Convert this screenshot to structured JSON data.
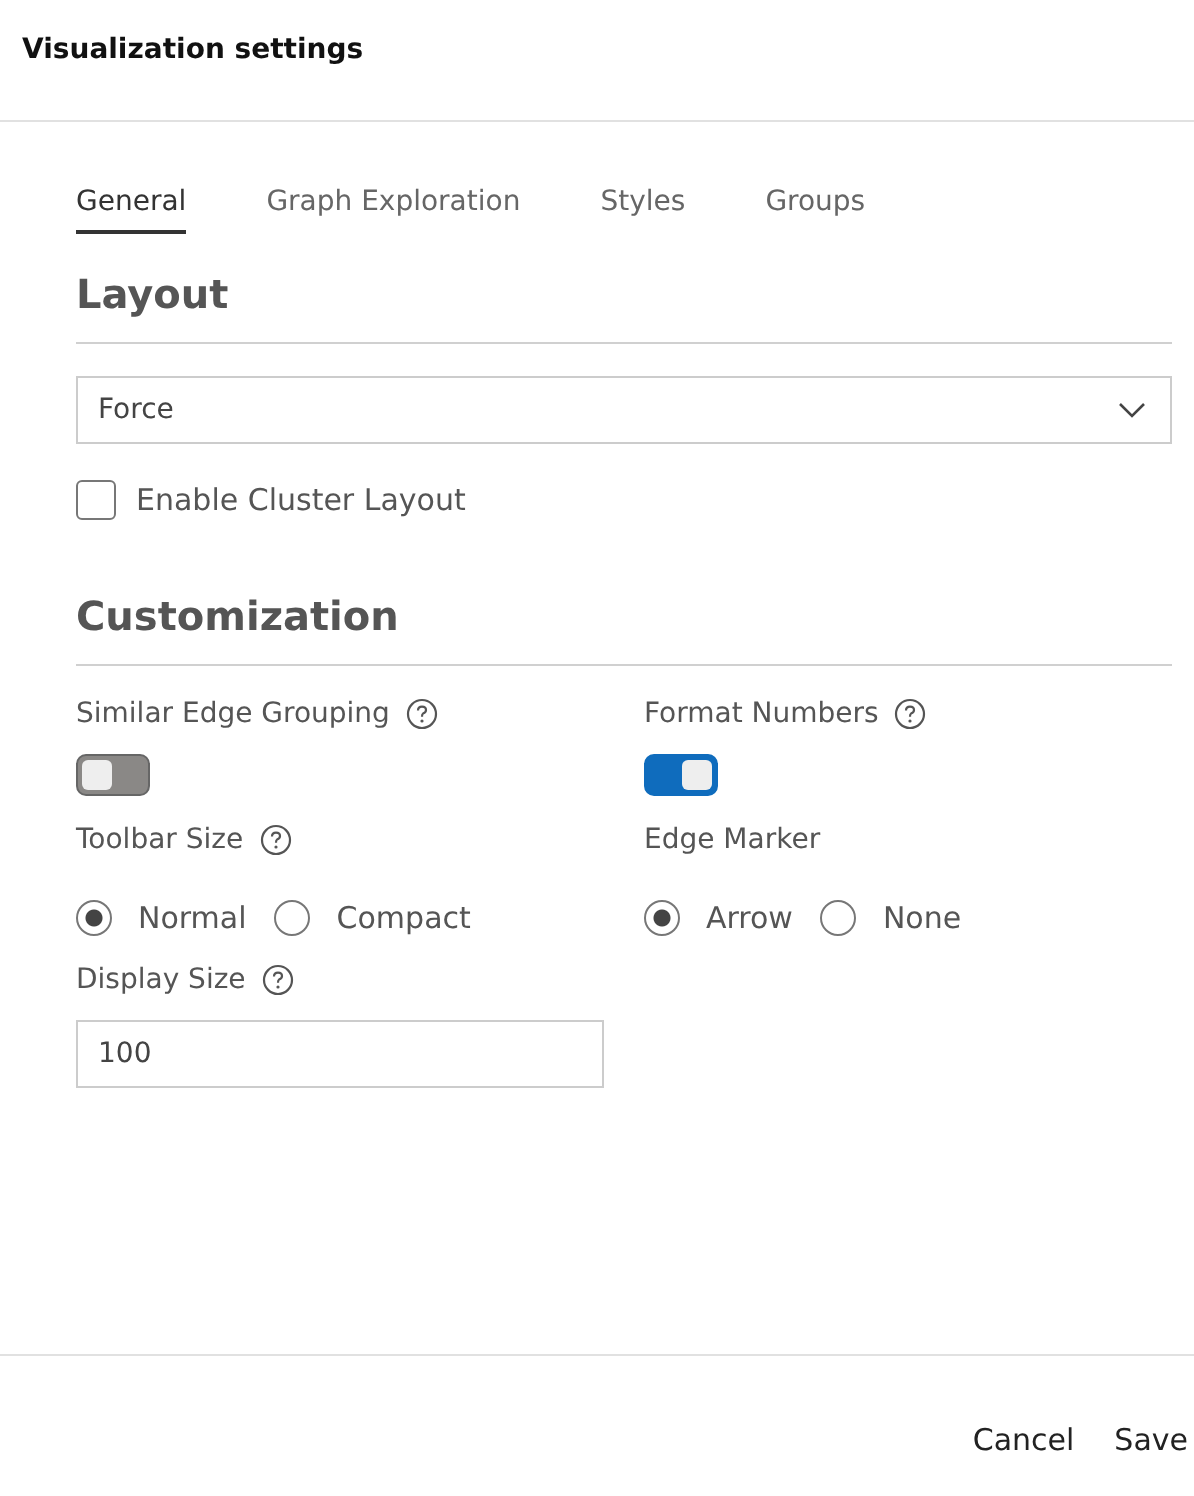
{
  "window": {
    "title": "Visualization settings"
  },
  "tabs": [
    {
      "label": "General",
      "selected": true
    },
    {
      "label": "Graph Exploration",
      "selected": false
    },
    {
      "label": "Styles",
      "selected": false
    },
    {
      "label": "Groups",
      "selected": false
    }
  ],
  "layout": {
    "heading": "Layout",
    "dropdown": {
      "value": "Force"
    },
    "checkbox": {
      "label": "Enable Cluster Layout",
      "checked": false
    }
  },
  "customization": {
    "heading": "Customization",
    "toggles": [
      {
        "label": "Similar Edge Grouping",
        "help": true,
        "on": false
      },
      {
        "label": "Format Numbers",
        "help": true,
        "on": true
      }
    ],
    "radio_groups": [
      {
        "label": "Toolbar Size",
        "help": true,
        "options": [
          {
            "label": "Normal",
            "selected": true
          },
          {
            "label": "Compact",
            "selected": false
          }
        ]
      },
      {
        "label": "Edge Marker",
        "help": false,
        "options": [
          {
            "label": "Arrow",
            "selected": true
          },
          {
            "label": "None",
            "selected": false
          }
        ]
      }
    ],
    "display_size": {
      "label": "Display Size",
      "help": true,
      "value": "100"
    }
  },
  "buttons": [
    "Cancel",
    "Save"
  ]
}
